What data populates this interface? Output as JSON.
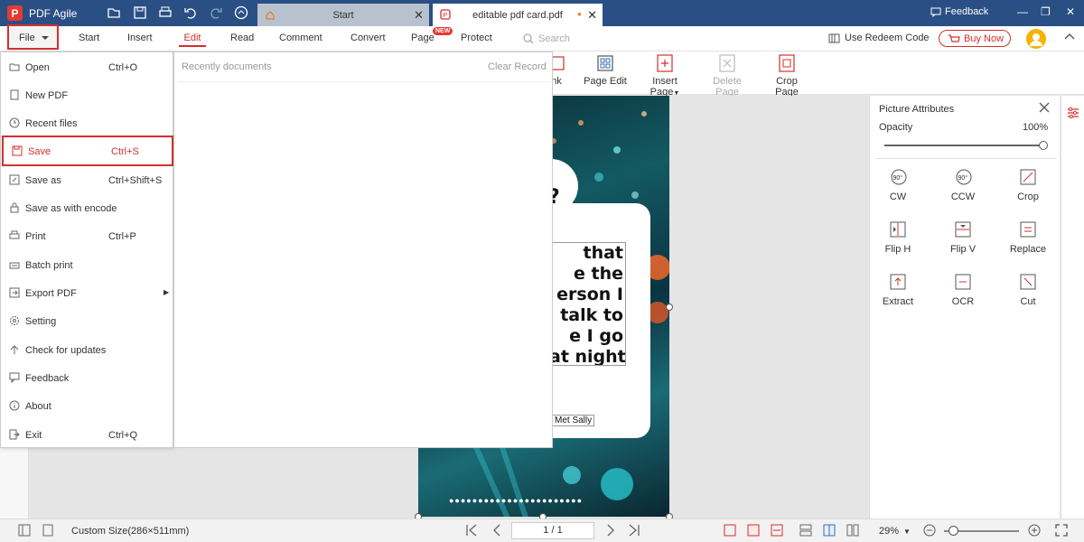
{
  "app": {
    "name": "PDF Agile"
  },
  "tabs": [
    {
      "label": "Start"
    },
    {
      "label": "editable pdf card.pdf"
    }
  ],
  "titlebar": {
    "feedback": "Feedback"
  },
  "ribbon": {
    "file": "File",
    "tabs": [
      "Start",
      "Insert",
      "Edit",
      "Read",
      "Comment",
      "Convert",
      "Page",
      "Protect"
    ],
    "new_badge": "NEW",
    "search_placeholder": "Search",
    "redeem": "Use Redeem Code",
    "buy_now": "Buy Now"
  },
  "toolbar": {
    "partial": "nk",
    "page_edit": "Page Edit",
    "insert_page": "Insert Page",
    "delete_page": "Delete Page",
    "crop_page": "Crop Page"
  },
  "file_menu": {
    "items": [
      {
        "label": "Open",
        "shortcut": "Ctrl+O"
      },
      {
        "label": "New PDF",
        "shortcut": ""
      },
      {
        "label": "Recent files",
        "shortcut": ""
      },
      {
        "label": "Save",
        "shortcut": "Ctrl+S"
      },
      {
        "label": "Save as",
        "shortcut": "Ctrl+Shift+S"
      },
      {
        "label": "Save as with encode",
        "shortcut": ""
      },
      {
        "label": "Print",
        "shortcut": "Ctrl+P"
      },
      {
        "label": "Batch print",
        "shortcut": ""
      },
      {
        "label": "Export PDF",
        "shortcut": ""
      },
      {
        "label": "Setting",
        "shortcut": ""
      },
      {
        "label": "Check for updates",
        "shortcut": ""
      },
      {
        "label": "Feedback",
        "shortcut": ""
      },
      {
        "label": "About",
        "shortcut": ""
      },
      {
        "label": "Exit",
        "shortcut": "Ctrl+Q"
      }
    ],
    "active_index": 3
  },
  "recent": {
    "title": "Recently documents",
    "clear": "Clear Record"
  },
  "document": {
    "quote_lines": [
      "that",
      "e the",
      "erson I",
      "talk to",
      "e I go",
      "at night."
    ],
    "quote_prefix": "?",
    "author": "Met Sally",
    "dots": "●●●●●●●●●●●●●●●●●●●●●●●"
  },
  "picture_panel": {
    "title": "Picture Attributes",
    "opacity_label": "Opacity",
    "opacity_value": "100%",
    "opacity_fraction": 1.0,
    "actions": [
      "CW",
      "CCW",
      "Crop",
      "Flip H",
      "Flip V",
      "Replace",
      "Extract",
      "OCR",
      "Cut"
    ],
    "rotate_badge": "90°"
  },
  "statusbar": {
    "size": "Custom Size(286×511mm)",
    "page": "1 / 1",
    "zoom": "29%",
    "zoom_fraction": 0.12
  },
  "colors": {
    "titlebar": "#2a4f84",
    "accent": "#d32f2f"
  }
}
